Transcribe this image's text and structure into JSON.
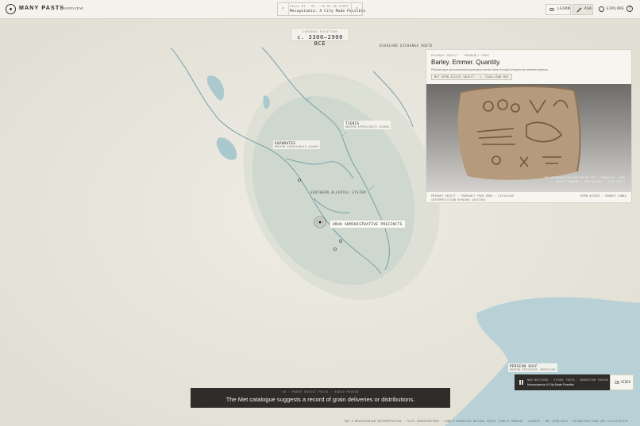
{
  "app": {
    "brand": "MANY PASTS",
    "back_label": "OVERVIEW"
  },
  "nav": {
    "subtitle": "Story 01 · 01 · 10 OF 48 STOPS NEXT",
    "title": "Mesopotamia: A City Made Possible",
    "prev_icon": "chevron-left-icon",
    "next_icon": "chevron-right-icon"
  },
  "toolbar": {
    "learn_label": "LEARN",
    "ask_label": "ASK",
    "explore_label": "EXPLORE",
    "help_label": "?"
  },
  "position": {
    "label": "CURRENT POSITION",
    "value": "c. 3300–2900 BCE"
  },
  "map": {
    "labels": {
      "highland": "HIGHLAND EXCHANGE ROUTE",
      "tigris_title": "TIGRIS",
      "tigris_sub": "MODERN APPROXIMATE COURSE",
      "euphrates_title": "EUPHRATES",
      "euphrates_sub": "MODERN APPROXIMATE COURSE",
      "alluvial": "SOUTHERN ALLUVIAL SYSTEM",
      "uruk": "URUK ADMINISTRATIVE PRECINCTS",
      "gulf_title": "PERSIAN GULF",
      "gulf_sub": "MODERN REFERENCE SHORELINE"
    },
    "colors": {
      "land": "#e9e6dc",
      "water": "#a9c9cf",
      "floodplain": "#c9d6cd",
      "river": "#6f9aa6"
    }
  },
  "object_card": {
    "eyebrow": "PRIMARY OBJECT · PROBABLY URUK",
    "title": "Barley. Emmer. Quantity.",
    "description": "Pictorial signs and numerical impressions remain close enough to inspect as material evidence.",
    "tag": "MET OPEN ACCESS OBJECT · c. 3100–2900 BCE",
    "image_credit_1": "THE METROPOLITAN MUSEUM OF ART · PURCHASE, 1988",
    "image_credit_2": "PUBLIC DOMAIN / OPEN ACCESS · 1988.433.3",
    "footer_line_1": "PRIMARY OBJECT · PROBABLY FROM URUK · CATALOGUE",
    "footer_line_2": "INTERPRETATION REMAINS CAUTIOUS",
    "footer_right": "OPEN ACCESS · SOURCE LINKS"
  },
  "caption": {
    "kicker": "10 · PAUSE OBJECT FOCUS · AUDIO PAUSED",
    "text": "The Met catalogue suggests a record of grain deliveries or distributions."
  },
  "now_watching": {
    "label": "NOW WATCHING · VISUAL FOCUS · NARRATION PAUSED",
    "title": "Mesopotamia: A City Made Possible",
    "video_label": "VIDEO",
    "icon": "pause-icon"
  },
  "attribution": "MAP & MESOPOTAMIAN INTERPRETATION · TILES OPENSTREETMAP · LAND & HYDROLOGY NATURAL EARTH (PUBLIC DOMAIN) · SOURCES · MET OPEN DATA · RECONSTRUCTIONS ARE ILLUSTRATIVE"
}
